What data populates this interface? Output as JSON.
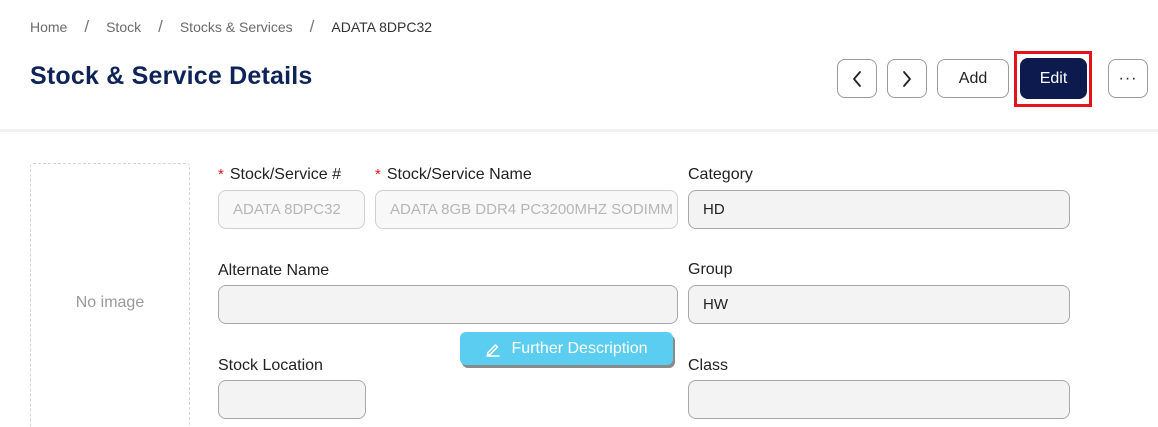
{
  "breadcrumb": {
    "items": [
      "Home",
      "Stock",
      "Stocks & Services"
    ],
    "current": "ADATA 8DPC32",
    "separator": "/"
  },
  "page": {
    "title": "Stock & Service Details"
  },
  "toolbar": {
    "prev_icon": "chevron-left-icon",
    "next_icon": "chevron-right-icon",
    "add_label": "Add",
    "edit_label": "Edit",
    "more_label": "···",
    "edit_highlight_color": "#e0141a",
    "edit_bg_color": "#0c1a4d"
  },
  "image": {
    "placeholder": "No image"
  },
  "form": {
    "stock_number": {
      "label": "Stock/Service #",
      "required_mark": "*",
      "value": "ADATA 8DPC32"
    },
    "stock_name": {
      "label": "Stock/Service Name",
      "required_mark": "*",
      "value": "ADATA 8GB DDR4 PC3200MHZ SODIMM"
    },
    "category": {
      "label": "Category",
      "value": "HD"
    },
    "alternate_name": {
      "label": "Alternate Name",
      "value": ""
    },
    "group": {
      "label": "Group",
      "value": "HW"
    },
    "further_description": {
      "label": "Further Description",
      "icon": "pencil-icon",
      "color": "#5bcdf0"
    },
    "stock_location": {
      "label": "Stock Location",
      "value": ""
    },
    "class": {
      "label": "Class",
      "value": ""
    }
  }
}
